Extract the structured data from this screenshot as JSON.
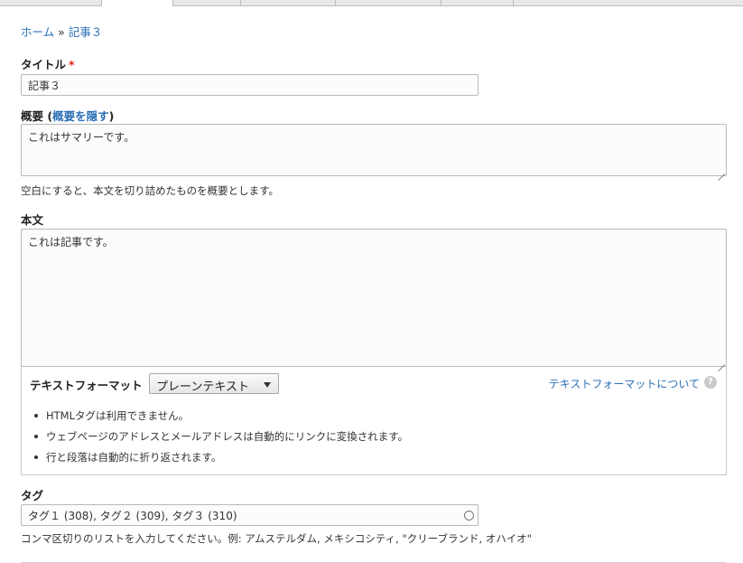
{
  "breadcrumb": {
    "home": "ホーム",
    "separator": "»",
    "current": "記事３"
  },
  "title_field": {
    "label": "タイトル",
    "required_mark": "*",
    "value": "記事３"
  },
  "summary_field": {
    "label": "概要",
    "paren_open": "(",
    "toggle_link": "概要を隠す",
    "paren_close": ")",
    "value": "これはサマリーです。",
    "description": "空白にすると、本文を切り詰めたものを概要とします。"
  },
  "body_field": {
    "label": "本文",
    "value": "これは記事です。"
  },
  "text_format": {
    "label": "テキストフォーマット",
    "selected": "プレーンテキスト",
    "about_link": "テキストフォーマットについて",
    "help_icon": "question-mark-icon",
    "tips": [
      "HTMLタグは利用できません。",
      "ウェブページのアドレスとメールアドレスは自動的にリンクに変換されます。",
      "行と段落は自動的に折り返されます。"
    ]
  },
  "tags_field": {
    "label": "タグ",
    "value": "タグ１ (308), タグ２ (309), タグ３ (310)",
    "description": "コンマ区切りのリストを入力してください。例: アムステルダム, メキシコシティ, \"クリーブランド, オハイオ\""
  },
  "colors": {
    "link": "#2b6fb6",
    "required": "#e0231b"
  }
}
